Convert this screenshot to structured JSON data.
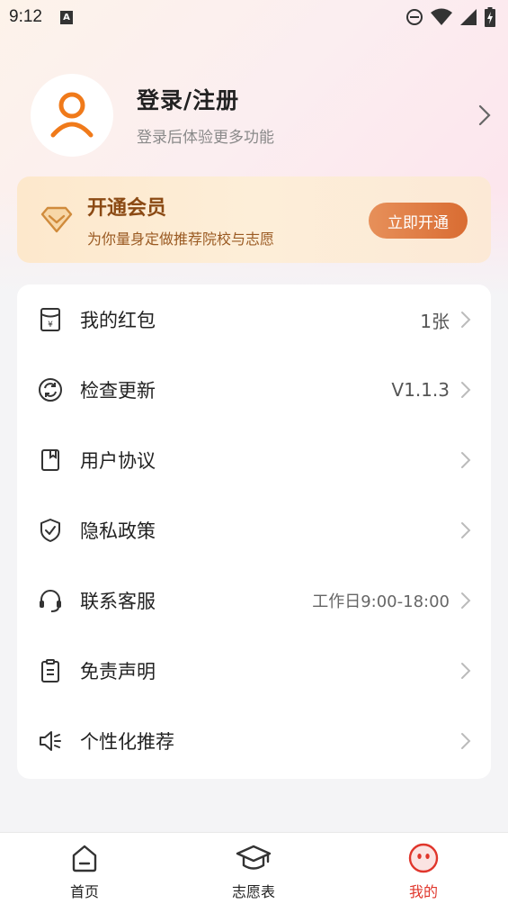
{
  "status_bar": {
    "time": "9:12",
    "notification_icon": "a-notification-icon",
    "icons": [
      "do-not-disturb-icon",
      "wifi-icon",
      "signal-icon",
      "battery-charging-icon"
    ]
  },
  "profile": {
    "title": "登录/注册",
    "subtitle": "登录后体验更多功能"
  },
  "vip": {
    "title": "开通会员",
    "subtitle": "为你量身定做推荐院校与志愿",
    "button": "立即开通"
  },
  "menu": {
    "items": [
      {
        "label": "我的红包",
        "value": "1张",
        "icon": "red-packet-icon"
      },
      {
        "label": "检查更新",
        "value": "V1.1.3",
        "icon": "refresh-icon"
      },
      {
        "label": "用户协议",
        "value": "",
        "icon": "agreement-icon"
      },
      {
        "label": "隐私政策",
        "value": "",
        "icon": "shield-check-icon"
      },
      {
        "label": "联系客服",
        "value": "工作日9:00-18:00",
        "icon": "headset-icon"
      },
      {
        "label": "免责声明",
        "value": "",
        "icon": "clipboard-icon"
      },
      {
        "label": "个性化推荐",
        "value": "",
        "icon": "speaker-icon"
      }
    ]
  },
  "bottom_nav": {
    "items": [
      {
        "label": "首页",
        "icon": "home-icon"
      },
      {
        "label": "志愿表",
        "icon": "graduation-cap-icon"
      },
      {
        "label": "我的",
        "icon": "profile-face-icon",
        "active": true
      }
    ]
  },
  "colors": {
    "accent_red": "#e0362c",
    "vip_button": "#d96c32",
    "vip_text": "#8b4a14",
    "avatar_orange": "#f07a1a"
  }
}
